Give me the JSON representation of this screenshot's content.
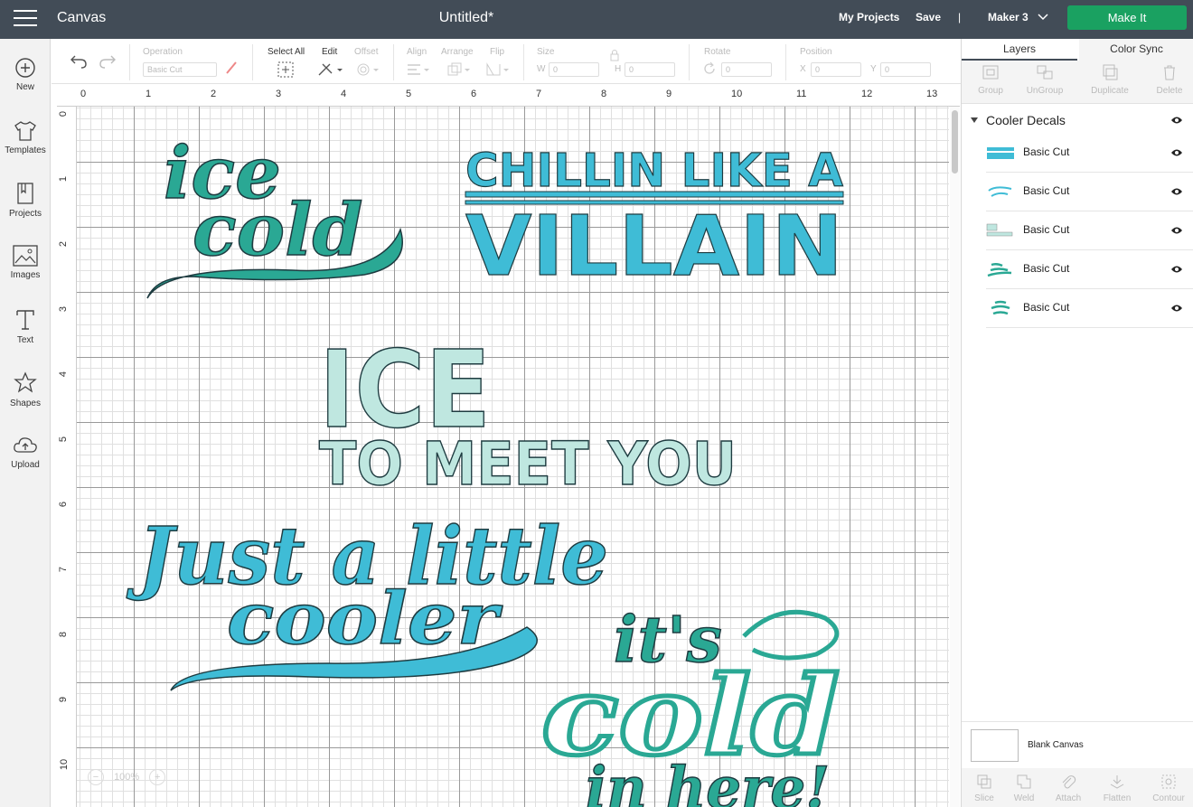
{
  "topbar": {
    "app_title": "Canvas",
    "doc_title": "Untitled*",
    "my_projects": "My Projects",
    "save": "Save",
    "divider": "|",
    "machine": "Maker 3",
    "make_it": "Make It"
  },
  "sidebar": {
    "items": [
      {
        "label": "New",
        "icon": "plus-circle-icon"
      },
      {
        "label": "Templates",
        "icon": "tshirt-icon"
      },
      {
        "label": "Projects",
        "icon": "book-icon"
      },
      {
        "label": "Images",
        "icon": "image-icon"
      },
      {
        "label": "Text",
        "icon": "text-icon"
      },
      {
        "label": "Shapes",
        "icon": "shapes-icon"
      },
      {
        "label": "Upload",
        "icon": "cloud-upload-icon"
      }
    ]
  },
  "toolbar": {
    "operation_label": "Operation",
    "operation_value": "Basic Cut",
    "select_all": "Select All",
    "edit": "Edit",
    "offset": "Offset",
    "align": "Align",
    "arrange": "Arrange",
    "flip": "Flip",
    "size": "Size",
    "w": "W",
    "h": "H",
    "w_value": "0",
    "h_value": "0",
    "rotate": "Rotate",
    "rotate_value": "0",
    "position": "Position",
    "x": "X",
    "y": "Y",
    "x_value": "0",
    "y_value": "0"
  },
  "ruler": {
    "top": [
      "0",
      "1",
      "2",
      "3",
      "4",
      "5",
      "6",
      "7",
      "8",
      "9",
      "10",
      "11",
      "12",
      "13"
    ],
    "left": [
      "0",
      "1",
      "2",
      "3",
      "4",
      "5",
      "6",
      "7",
      "8",
      "9",
      "10"
    ]
  },
  "zoom": {
    "minus": "−",
    "value": "100%",
    "plus": "+"
  },
  "canvas_text": {
    "ice_cold_1": "ice",
    "ice_cold_2": "cold",
    "villain_1": "CHILLIN LIKE A",
    "villain_2": "VILLAIN",
    "ice_meet_1": "ICE",
    "ice_meet_2": "TO MEET YOU",
    "cooler_1": "Just a little",
    "cooler_2": "cooler",
    "its_cold_1": "it's",
    "its_cold_2": "cold",
    "its_cold_3": "in here!"
  },
  "colors": {
    "teal_green": "#2aa894",
    "sky_blue": "#3fbcd6",
    "mint": "#bfe7e0",
    "dark_outline": "#1e3b40",
    "make_it_green": "#1aa161",
    "topbar_bg": "#424c57"
  },
  "rightpanel": {
    "tab_layers": "Layers",
    "tab_color_sync": "Color Sync",
    "tools": [
      "Group",
      "UnGroup",
      "Duplicate",
      "Delete"
    ],
    "group_name": "Cooler Decals",
    "layers": [
      {
        "name": "Basic Cut",
        "thumb": "CHILLIN LIKE A VILLAIN"
      },
      {
        "name": "Basic Cut",
        "thumb": "Just a little cooler"
      },
      {
        "name": "Basic Cut",
        "thumb": "ICE TO MEET YOU"
      },
      {
        "name": "Basic Cut",
        "thumb": "ice cold"
      },
      {
        "name": "Basic Cut",
        "thumb": "it's cold in here"
      }
    ],
    "blank_canvas": "Blank Canvas",
    "bottom_tools": [
      "Slice",
      "Weld",
      "Attach",
      "Flatten",
      "Contour"
    ]
  }
}
